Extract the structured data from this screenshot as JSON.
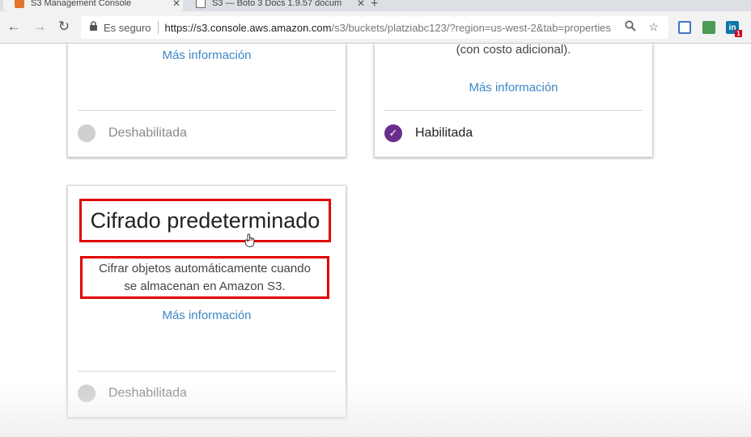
{
  "browser": {
    "tabs": [
      {
        "title": "S3 Management Console",
        "active": true,
        "icon": "aws-icon"
      },
      {
        "title": "S3 — Boto 3 Docs 1.9.57 docum",
        "active": false,
        "icon": "document-icon"
      }
    ],
    "toolbar": {
      "secure_label": "Es seguro",
      "url_host": "https://s3.console.aws.amazon.com",
      "url_path": "/s3/buckets/platziabc123/?region=us-west-2&tab=properties"
    },
    "extensions": [
      {
        "icon": "extension-c-icon"
      },
      {
        "icon": "extension-inbox-icon"
      },
      {
        "icon": "linkedin-icon",
        "badge": "1",
        "label": "in"
      }
    ]
  },
  "cards": {
    "card1": {
      "more_info": "Más información",
      "status": "Deshabilitada"
    },
    "card2": {
      "description": "eventos de datos de CloudTrail (con costo adicional).",
      "more_info": "Más información",
      "status": "Habilitada"
    },
    "card3": {
      "title": "Cifrado predeterminado",
      "description_line1": "Cifrar objetos automáticamente cuando",
      "description_line2": "se almacenan en Amazon S3.",
      "more_info": "Más información",
      "status": "Deshabilitada"
    }
  },
  "colors": {
    "link": "#3d86c6",
    "enabled_check": "#6a2d8c",
    "highlight_box": "#e00000"
  }
}
